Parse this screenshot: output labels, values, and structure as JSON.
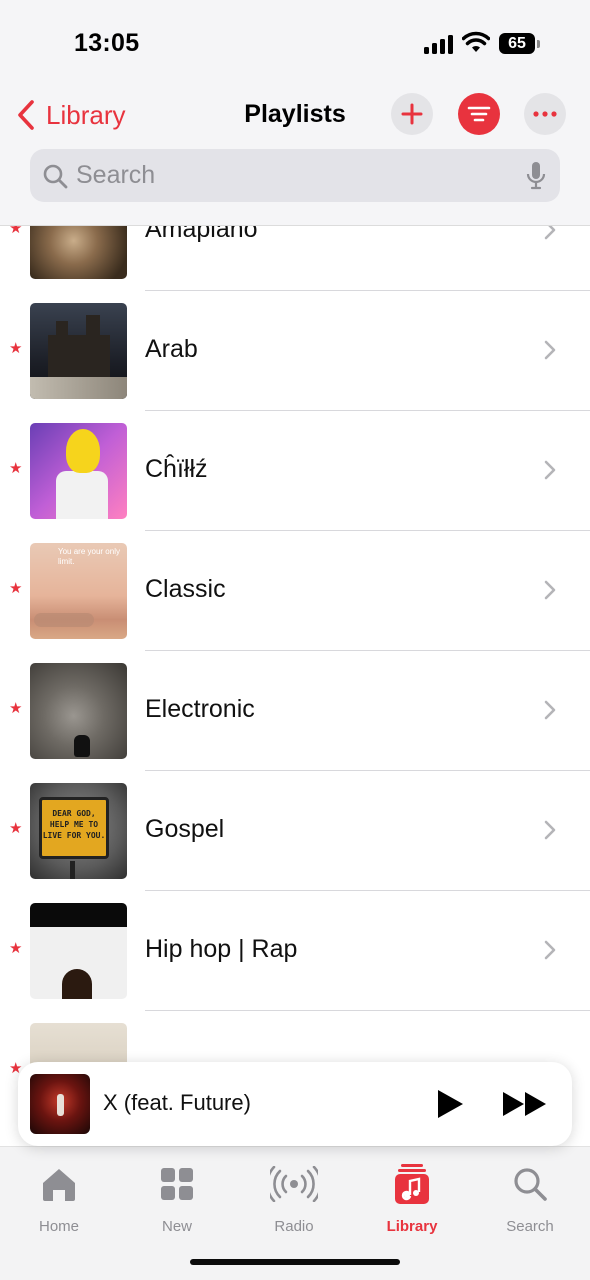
{
  "status_bar": {
    "time": "13:05",
    "battery": "65"
  },
  "header": {
    "back_label": "Library",
    "title": "Playlists",
    "add_button": "add-icon",
    "sort_button": "sort-icon",
    "more_button": "more-icon"
  },
  "search": {
    "placeholder": "Search",
    "value": ""
  },
  "playlists": [
    {
      "name": "Amapiano",
      "starred": true
    },
    {
      "name": "Arab",
      "starred": true
    },
    {
      "name": "Cĥïłłź",
      "starred": true
    },
    {
      "name": "Classic",
      "starred": true,
      "artwork_text": "You are your only limit."
    },
    {
      "name": "Electronic",
      "starred": true
    },
    {
      "name": "Gospel",
      "starred": true,
      "artwork_text": "DEAR GOD, HELP ME TO LIVE FOR YOU."
    },
    {
      "name": "Hip hop | Rap",
      "starred": true
    },
    {
      "name": "",
      "starred": true
    }
  ],
  "now_playing": {
    "title": "X (feat. Future)"
  },
  "tabs": [
    {
      "label": "Home",
      "icon": "home-icon",
      "active": false
    },
    {
      "label": "New",
      "icon": "grid-icon",
      "active": false
    },
    {
      "label": "Radio",
      "icon": "radio-icon",
      "active": false
    },
    {
      "label": "Library",
      "icon": "library-icon",
      "active": true
    },
    {
      "label": "Search",
      "icon": "search-icon",
      "active": false
    }
  ],
  "colors": {
    "accent": "#e8333e",
    "secondary_text": "#8e8e93"
  }
}
